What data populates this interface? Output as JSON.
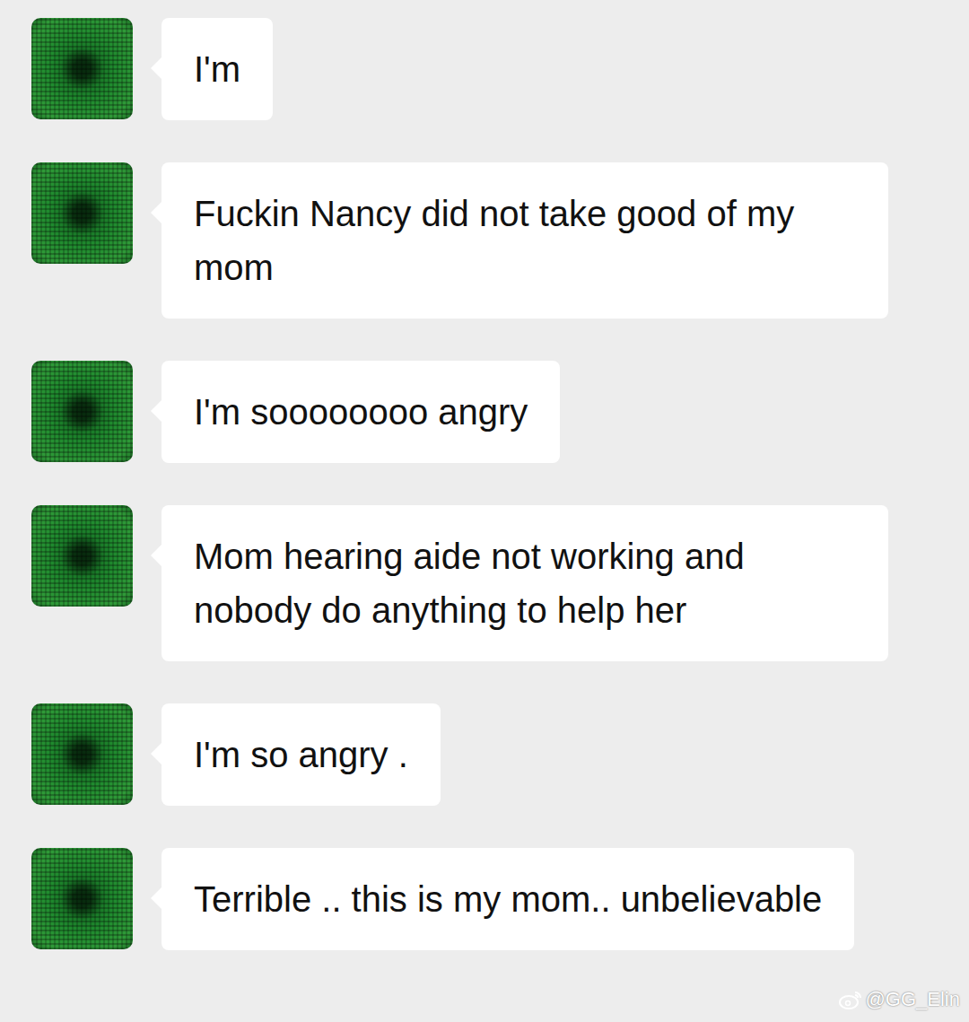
{
  "messages": [
    {
      "text": "I'm"
    },
    {
      "text": "Fuckin Nancy did not take good of my mom"
    },
    {
      "text": "I'm soooooooo angry"
    },
    {
      "text": "Mom hearing aide not working and nobody do anything to help her"
    },
    {
      "text": "I'm so angry ."
    },
    {
      "text": "Terrible .. this is my mom.. unbelievable"
    }
  ],
  "watermark": "@GG_Elin"
}
